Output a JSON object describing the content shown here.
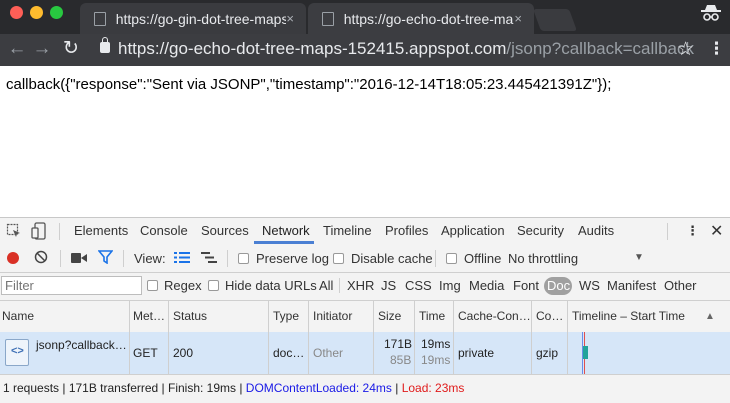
{
  "browser": {
    "tabs": [
      {
        "title": "https://go-gin-dot-tree-maps",
        "close": "×"
      },
      {
        "title": "https://go-echo-dot-tree-maps",
        "close": "×"
      }
    ],
    "url_host": "https://go-echo-dot-tree-maps-152415.appspot.com",
    "url_path": "/jsonp?callback=callback",
    "nav": {
      "back": "←",
      "forward": "→",
      "reload": "↻"
    },
    "icons": {
      "star": "☆",
      "menu": "⋮",
      "incognito": "incognito-icon"
    }
  },
  "page": {
    "body_text": "callback({\"response\":\"Sent via JSONP\",\"timestamp\":\"2016-12-14T18:05:23.445421391Z\"});"
  },
  "devtools": {
    "tabs": [
      "Elements",
      "Console",
      "Sources",
      "Network",
      "Timeline",
      "Profiles",
      "Application",
      "Security",
      "Audits"
    ],
    "active_tab": "Network",
    "controls": {
      "view_label": "View:",
      "preserve_log": "Preserve log",
      "disable_cache": "Disable cache",
      "offline": "Offline",
      "throttling": "No throttling"
    },
    "filter": {
      "placeholder": "Filter",
      "regex": "Regex",
      "hide_data_urls": "Hide data URLs",
      "types": [
        "All",
        "XHR",
        "JS",
        "CSS",
        "Img",
        "Media",
        "Font",
        "Doc",
        "WS",
        "Manifest",
        "Other"
      ],
      "selected_type": "Doc"
    },
    "table": {
      "headers": [
        "Name",
        "Met…",
        "Status",
        "Type",
        "Initiator",
        "Size",
        "Time",
        "Cache-Con…",
        "Co…",
        "Timeline – Start Time"
      ],
      "rows": [
        {
          "name": "jsonp?callback…",
          "method": "GET",
          "status": "200",
          "type": "doc…",
          "initiator": "Other",
          "size": "171B",
          "size_content": "85B",
          "time": "19ms",
          "time_latency": "19ms",
          "cache_control": "private",
          "content_encoding": "gzip"
        }
      ]
    },
    "status_bar": {
      "summary": "1 requests | 171B transferred | Finish: 19ms | ",
      "dom_content_loaded": "DOMContentLoaded: 24ms",
      "sep": " | ",
      "load": "Load: 23ms"
    },
    "colors": {
      "record": "#d93025",
      "dom_blue": "#1a1ae6",
      "load_red": "#e01b1b",
      "selected_row": "#d6e6f8"
    }
  }
}
